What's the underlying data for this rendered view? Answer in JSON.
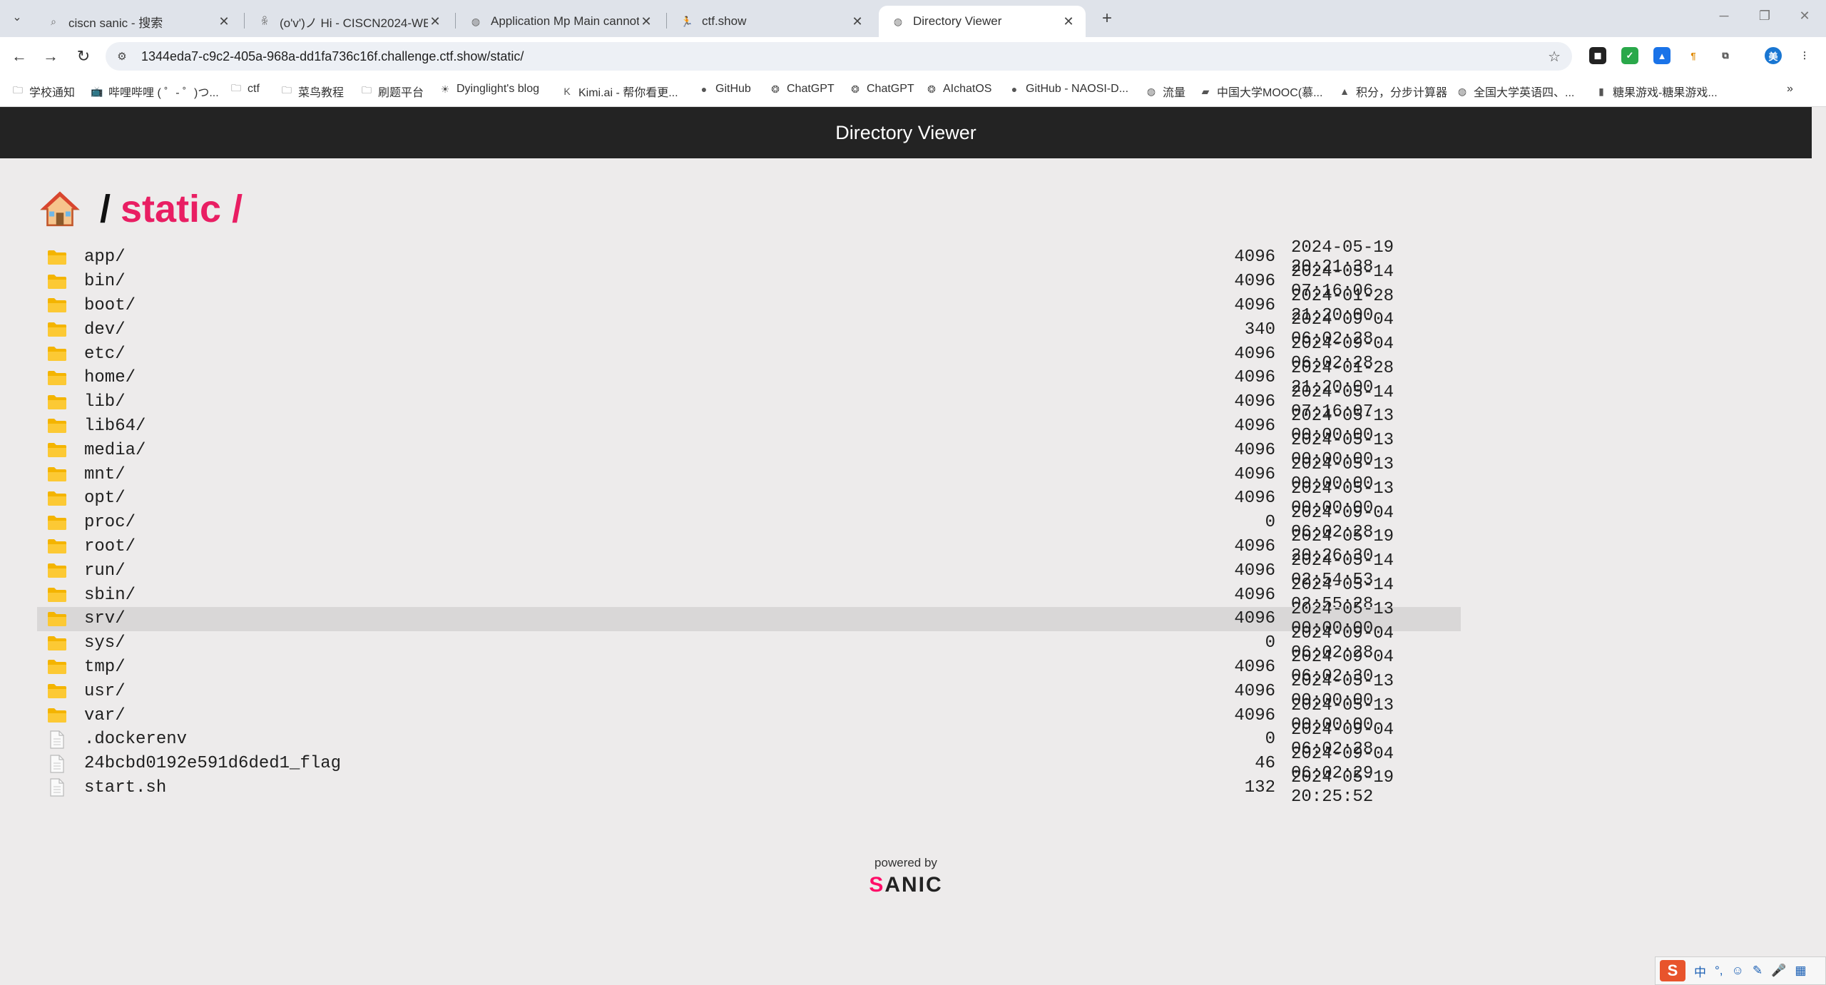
{
  "browser": {
    "tabs": [
      {
        "title": "ciscn sanic - 搜索",
        "icon": "search-icon",
        "active": false
      },
      {
        "title": "(o'v')ノ Hi - CISCN2024-WEB",
        "icon": "person-icon",
        "active": false
      },
      {
        "title": "Application Mp Main cannot",
        "icon": "globe-icon",
        "active": false
      },
      {
        "title": "ctf.show",
        "icon": "runner-icon",
        "active": false
      },
      {
        "title": "Directory Viewer",
        "icon": "globe-icon",
        "active": true
      }
    ],
    "new_tab_label": "+",
    "url": "1344eda7-c9c2-405a-968a-dd1fa736c16f.challenge.ctf.show/static/",
    "bookmarks": [
      {
        "label": "学校通知",
        "icon": "folder-icon"
      },
      {
        "label": "哔哩哔哩 ( ゜- ゜)つ...",
        "icon": "bilibili-icon"
      },
      {
        "label": "ctf",
        "icon": "folder-icon"
      },
      {
        "label": "菜鸟教程",
        "icon": "folder-icon"
      },
      {
        "label": "刷题平台",
        "icon": "folder-icon"
      },
      {
        "label": "Dyinglight's blog",
        "icon": "sun-icon"
      },
      {
        "label": "Kimi.ai - 帮你看更...",
        "icon": "kimi-icon"
      },
      {
        "label": "GitHub",
        "icon": "github-icon"
      },
      {
        "label": "ChatGPT",
        "icon": "chatgpt-icon"
      },
      {
        "label": "ChatGPT",
        "icon": "chatgpt-icon"
      },
      {
        "label": "AIchatOS",
        "icon": "chatgpt-icon"
      },
      {
        "label": "GitHub - NAOSI-D...",
        "icon": "github-icon"
      },
      {
        "label": "流量",
        "icon": "globe-icon"
      },
      {
        "label": "中国大学MOOC(慕...",
        "icon": "mooc-icon"
      },
      {
        "label": "积分，分步计算器",
        "icon": "calculator-icon"
      },
      {
        "label": "全国大学英语四、...",
        "icon": "globe-icon"
      },
      {
        "label": "糖果游戏-糖果游戏...",
        "icon": "candy-icon"
      }
    ]
  },
  "page": {
    "header_title": "Directory Viewer",
    "breadcrumb_sep": "/",
    "breadcrumb_path": "static /",
    "entries": [
      {
        "name": "app/",
        "type": "dir",
        "size": "4096",
        "date": "2024-05-19 20:21:38"
      },
      {
        "name": "bin/",
        "type": "dir",
        "size": "4096",
        "date": "2024-05-14 07:16:06"
      },
      {
        "name": "boot/",
        "type": "dir",
        "size": "4096",
        "date": "2024-01-28 21:20:00"
      },
      {
        "name": "dev/",
        "type": "dir",
        "size": "340",
        "date": "2024-09-04 06:02:28"
      },
      {
        "name": "etc/",
        "type": "dir",
        "size": "4096",
        "date": "2024-09-04 06:02:28"
      },
      {
        "name": "home/",
        "type": "dir",
        "size": "4096",
        "date": "2024-01-28 21:20:00"
      },
      {
        "name": "lib/",
        "type": "dir",
        "size": "4096",
        "date": "2024-05-14 07:16:07"
      },
      {
        "name": "lib64/",
        "type": "dir",
        "size": "4096",
        "date": "2024-05-13 00:00:00"
      },
      {
        "name": "media/",
        "type": "dir",
        "size": "4096",
        "date": "2024-05-13 00:00:00"
      },
      {
        "name": "mnt/",
        "type": "dir",
        "size": "4096",
        "date": "2024-05-13 00:00:00"
      },
      {
        "name": "opt/",
        "type": "dir",
        "size": "4096",
        "date": "2024-05-13 00:00:00"
      },
      {
        "name": "proc/",
        "type": "dir",
        "size": "0",
        "date": "2024-09-04 06:02:28"
      },
      {
        "name": "root/",
        "type": "dir",
        "size": "4096",
        "date": "2024-05-19 20:26:30"
      },
      {
        "name": "run/",
        "type": "dir",
        "size": "4096",
        "date": "2024-05-14 02:54:53"
      },
      {
        "name": "sbin/",
        "type": "dir",
        "size": "4096",
        "date": "2024-05-14 02:55:28"
      },
      {
        "name": "srv/",
        "type": "dir",
        "size": "4096",
        "date": "2024-05-13 00:00:00",
        "hover": true
      },
      {
        "name": "sys/",
        "type": "dir",
        "size": "0",
        "date": "2024-09-04 06:02:28"
      },
      {
        "name": "tmp/",
        "type": "dir",
        "size": "4096",
        "date": "2024-09-04 06:02:30"
      },
      {
        "name": "usr/",
        "type": "dir",
        "size": "4096",
        "date": "2024-05-13 00:00:00"
      },
      {
        "name": "var/",
        "type": "dir",
        "size": "4096",
        "date": "2024-05-13 00:00:00"
      },
      {
        "name": ".dockerenv",
        "type": "file",
        "size": "0",
        "date": "2024-09-04 06:02:28"
      },
      {
        "name": "24bcbd0192e591d6ded1_flag",
        "type": "file",
        "size": "46",
        "date": "2024-09-04 06:02:29"
      },
      {
        "name": "start.sh",
        "type": "file",
        "size": "132",
        "date": "2024-05-19 20:25:52"
      }
    ],
    "footer_powered_by": "powered by",
    "footer_logo_text": "SANIC"
  },
  "taskbar": {
    "ime_label": "中"
  },
  "colors": {
    "header_bg": "#232323",
    "breadcrumb_accent": "#e91e63",
    "folder": "#f4b400",
    "hover_row": "#d9d7d7"
  }
}
